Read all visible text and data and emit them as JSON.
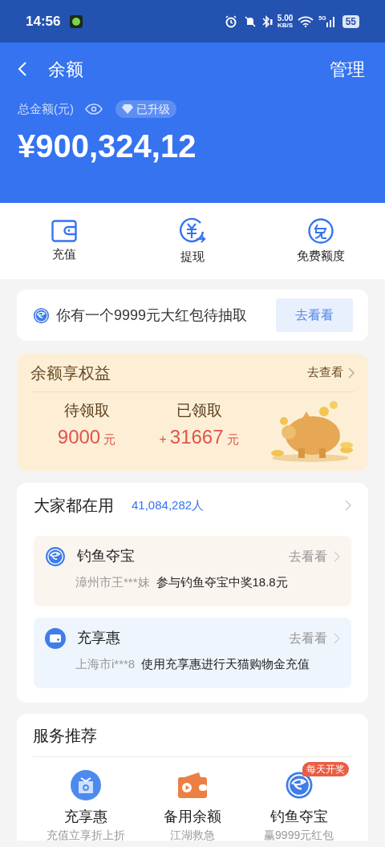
{
  "status_bar": {
    "time": "14:56",
    "net_speed": "5.00",
    "net_speed_unit": "KB/S",
    "network": "5G",
    "battery": "55"
  },
  "header": {
    "title": "余额",
    "action": "管理",
    "balance_label": "总金额(元)",
    "badge": "已升级",
    "balance": "¥900,324,12"
  },
  "actions": [
    {
      "kind": "wallet",
      "label": "充值"
    },
    {
      "kind": "withdraw",
      "label": "提现"
    },
    {
      "kind": "free",
      "label": "免费额度"
    }
  ],
  "promo": {
    "text": "你有一个9999元大红包待抽取",
    "button": "去看看"
  },
  "benefits": {
    "title": "余额享权益",
    "link": "去查看",
    "stats": [
      {
        "label": "待领取",
        "value": "9000",
        "unit": "元"
      },
      {
        "label": "已领取",
        "prefix": "+",
        "value": "31667",
        "unit": "元"
      }
    ]
  },
  "popular": {
    "title": "大家都在用",
    "count": "41,084,282人",
    "items": [
      {
        "kind": "fishing",
        "title": "钓鱼夺宝",
        "link": "去看看",
        "user": "漳州市王***妹",
        "activity": "参与钓鱼夺宝中奖18.8元"
      },
      {
        "kind": "card",
        "title": "充享惠",
        "link": "去看看",
        "user": "上海市i***8",
        "activity": "使用充享惠进行天猫购物金充值"
      }
    ]
  },
  "services": {
    "title": "服务推荐",
    "items": [
      {
        "kind": "gift",
        "title": "充享惠",
        "subtitle": "充值立享折上折"
      },
      {
        "kind": "wallet",
        "title": "备用余额",
        "subtitle": "江湖救急"
      },
      {
        "kind": "fishing",
        "title": "钓鱼夺宝",
        "subtitle": "赢9999元红包",
        "badge": "每天开奖"
      }
    ]
  }
}
